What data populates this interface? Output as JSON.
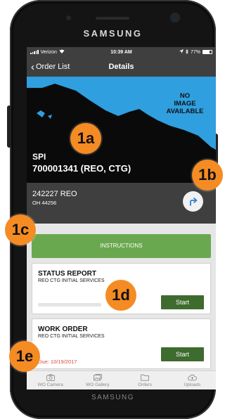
{
  "device": {
    "brand_top": "SAMSUNG",
    "brand_bottom": "SAMSUNG"
  },
  "status_bar": {
    "carrier": "Verizon",
    "time": "10:39 AM",
    "battery_text": "77%",
    "battery_level": 0.77
  },
  "nav": {
    "back_label": "Order List",
    "title": "Details"
  },
  "hero": {
    "placeholder_line1": "NO",
    "placeholder_line2": "IMAGE",
    "placeholder_line3": "AVAILABLE",
    "code": "SPI",
    "order_number": "700001341 (REO, CTG)"
  },
  "info": {
    "address_line1": "242227 REO",
    "address_line2": "OH  44256"
  },
  "instructions_label": "INSTRUCTIONS",
  "tasks": [
    {
      "title": "STATUS REPORT",
      "subtitle": "REO CTG INITIAL SERVICES",
      "button": "Start",
      "due": ""
    },
    {
      "title": "WORK ORDER",
      "subtitle": "REO CTG INITIAL SERVICES",
      "button": "Start",
      "due": "Due: 10/19/2017"
    }
  ],
  "tabs": [
    {
      "label": "WO Camera",
      "icon": "camera-icon"
    },
    {
      "label": "WO Gallery",
      "icon": "gallery-icon"
    },
    {
      "label": "Orders",
      "icon": "folder-icon"
    },
    {
      "label": "Uploads",
      "icon": "cloud-upload-icon"
    }
  ],
  "callouts": [
    {
      "label": "1a"
    },
    {
      "label": "1b"
    },
    {
      "label": "1c"
    },
    {
      "label": "1d"
    },
    {
      "label": "1e"
    }
  ],
  "colors": {
    "accent_green": "#6aa84f",
    "button_green": "#3e6b2e",
    "callout_orange": "#f58b23",
    "header_gray": "#3f3f3f",
    "sky_blue": "#2f9fe0",
    "due_red": "#d64a3c"
  }
}
